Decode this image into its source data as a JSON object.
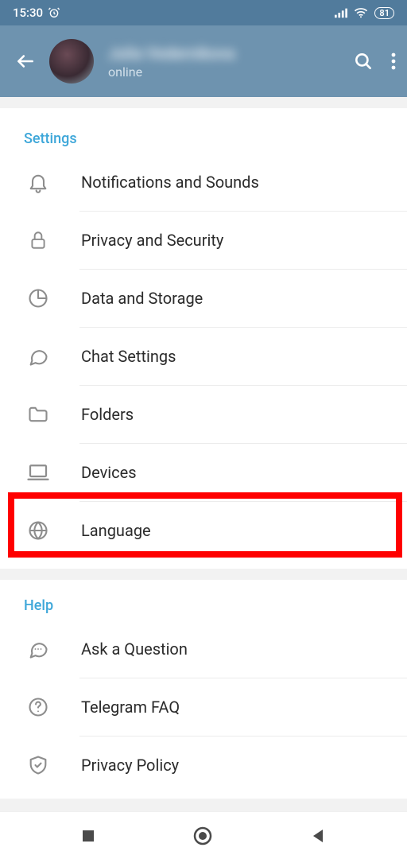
{
  "status": {
    "time": "15:30",
    "battery": "81"
  },
  "header": {
    "name": "Julia Vedernikova",
    "status": "online"
  },
  "sections": {
    "settings": {
      "title": "Settings",
      "items": [
        {
          "label": "Notifications and Sounds"
        },
        {
          "label": "Privacy and Security"
        },
        {
          "label": "Data and Storage"
        },
        {
          "label": "Chat Settings"
        },
        {
          "label": "Folders"
        },
        {
          "label": "Devices"
        },
        {
          "label": "Language"
        }
      ]
    },
    "help": {
      "title": "Help",
      "items": [
        {
          "label": "Ask a Question"
        },
        {
          "label": "Telegram FAQ"
        },
        {
          "label": "Privacy Policy"
        }
      ]
    }
  }
}
